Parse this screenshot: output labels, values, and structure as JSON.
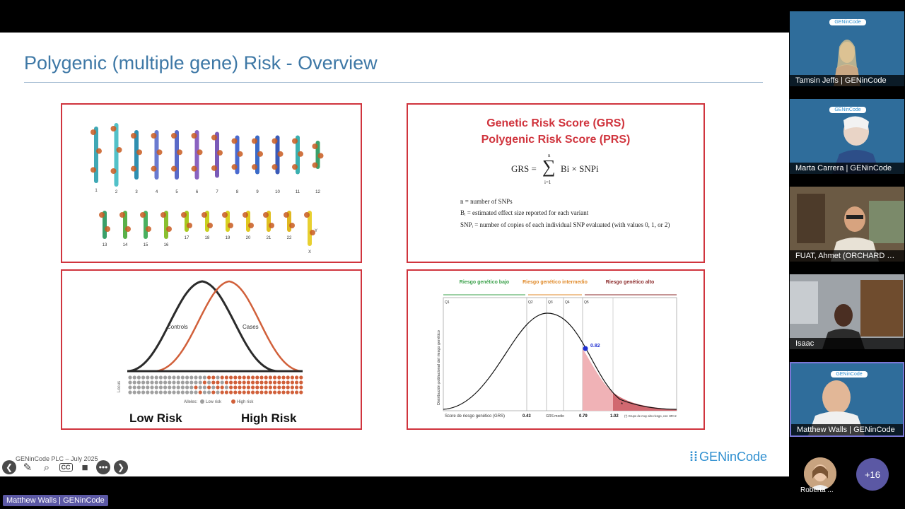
{
  "slide": {
    "title": "Polygenic (multiple gene) Risk - Overview",
    "footer": "GENinCode PLC – July 2025",
    "brand": "GENinCode",
    "chromosomes": {
      "row1": [
        "1",
        "2",
        "3",
        "4",
        "5",
        "6",
        "7",
        "8",
        "9",
        "10",
        "11",
        "12"
      ],
      "row2": [
        "13",
        "14",
        "15",
        "16",
        "17",
        "18",
        "19",
        "20",
        "21",
        "22",
        "X"
      ],
      "y_label": "Y"
    },
    "formula_panel": {
      "title1": "Genetic Risk Score (GRS)",
      "title2": "Polygenic Risk Score (PRS)",
      "formula_lhs": "GRS =",
      "formula_sum_top": "n",
      "formula_sum_bottom": "i=1",
      "formula_rhs": "Bi × SNPi",
      "def_n": "n = number of SNPs",
      "def_b": "Bᵢ = estimated effect size reported for each variant",
      "def_snp": "SNPᵢ = number of copies of each individual SNP evaluated (with values 0, 1, or 2)"
    },
    "distribution_panel": {
      "controls_label": "Controls",
      "cases_label": "Cases",
      "locus_label": "Locus",
      "alleles_label": "Alleles:",
      "low_risk_legend": "Low risk",
      "high_risk_legend": "High risk",
      "low_risk": "Low Risk",
      "high_risk": "High Risk"
    },
    "grs_chart": {
      "zone_low": "Riesgo genético bajo",
      "zone_mid": "Riesgo genético intermedio",
      "zone_high": "Riesgo genético alto",
      "quintiles": [
        "Q1",
        "Q2",
        "Q3",
        "Q4",
        "Q5"
      ],
      "ylabel": "Distribución poblacional del riesgo genético",
      "xlabel": "Score de riesgo genético (GRS)",
      "tick_043": "0.43",
      "tick_mid": "GRS medio",
      "tick_079": "0.79",
      "tick_102": "1.02",
      "note": "(*) Grupo de muy alto riesgo, con HR>2",
      "point_label": "0.82"
    }
  },
  "controls": {
    "back": "back-icon",
    "pen": "pen-icon",
    "zoom": "zoom-icon",
    "cc": "CC",
    "video": "video-icon",
    "more": "more-icon",
    "forward": "forward-icon"
  },
  "speaker_tag": "Matthew Walls | GENinCode",
  "participants": [
    {
      "name": "Tamsin Jeffs | GENinCode"
    },
    {
      "name": "Marta Carrera | GENinCode"
    },
    {
      "name": "FUAT, Ahmet (ORCHARD C..."
    },
    {
      "name": "Isaac"
    },
    {
      "name": "Matthew Walls | GENinCode"
    }
  ],
  "tile_logo": "GENinCode",
  "extra_participant": "Roberta ...",
  "more_participants": "+16"
}
